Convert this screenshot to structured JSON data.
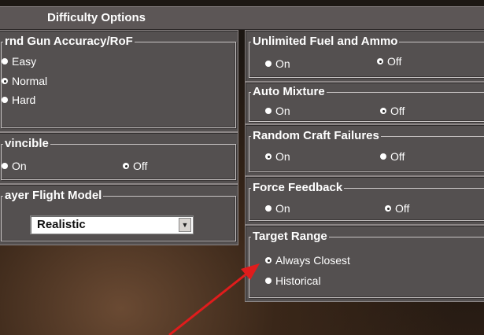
{
  "window": {
    "title": "Difficulty Options"
  },
  "gnd_gun": {
    "legend": "rnd Gun Accuracy/RoF",
    "options": [
      {
        "label": "Easy",
        "selected": false
      },
      {
        "label": "Normal",
        "selected": true
      },
      {
        "label": "Hard",
        "selected": false
      }
    ]
  },
  "invincible": {
    "legend": "vincible",
    "on_label": "On",
    "off_label": "Off",
    "selected": "Off"
  },
  "player_flight_model": {
    "legend": "ayer Flight Model",
    "value": "Realistic",
    "dropdown_icon": "chevron-down-icon"
  },
  "unlimited_fuel": {
    "legend": "Unlimited Fuel and Ammo",
    "on_label": "On",
    "off_label": "Off",
    "selected": "Off"
  },
  "auto_mixture": {
    "legend": "Auto Mixture",
    "on_label": "On",
    "off_label": "Off",
    "selected": "Off"
  },
  "random_failures": {
    "legend": "Random Craft Failures",
    "on_label": "On",
    "off_label": "Off",
    "selected": "On"
  },
  "force_feedback": {
    "legend": "Force Feedback",
    "on_label": "On",
    "off_label": "Off",
    "selected": "Off"
  },
  "target_range": {
    "legend": "Target Range",
    "options": [
      {
        "label": "Always Closest",
        "selected": true
      },
      {
        "label": "Historical",
        "selected": false
      }
    ]
  },
  "colors": {
    "panel": "#545050",
    "titlebar": "#5c5656",
    "text": "#ffffff",
    "annotation_arrow": "#e01c1c"
  }
}
